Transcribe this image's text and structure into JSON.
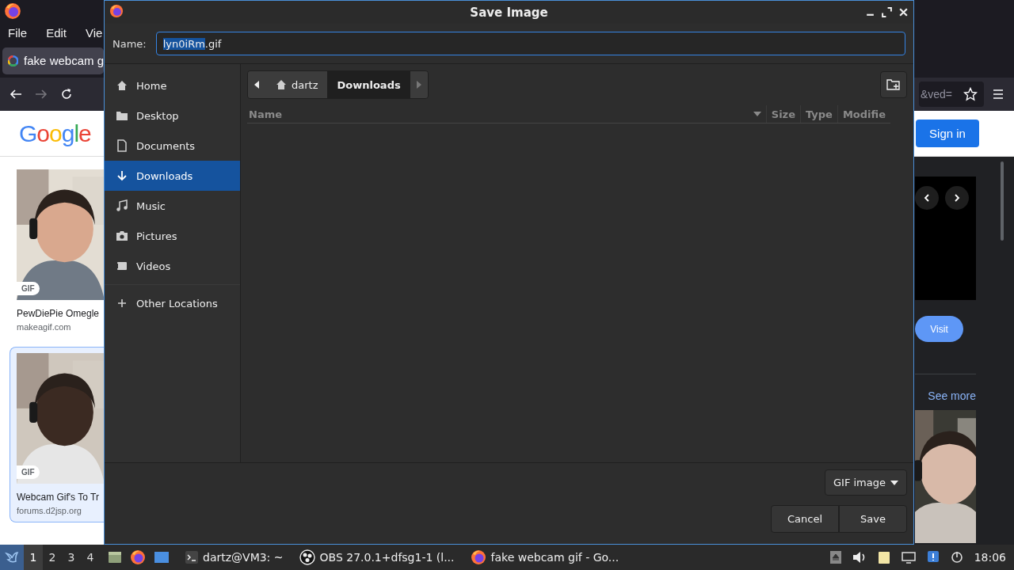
{
  "browser": {
    "menu": [
      "File",
      "Edit",
      "Vie"
    ],
    "tab": {
      "title": "fake webcam g"
    },
    "url_tail": "&ved=",
    "logo": "Google",
    "sign_in": "Sign in",
    "results": [
      {
        "badge": "GIF",
        "title": "PewDiePie Omegle",
        "source": "makeagif.com",
        "selected": false
      },
      {
        "badge": "GIF",
        "title": "Webcam Gif's To Tr",
        "source": "forums.d2jsp.org",
        "selected": true
      }
    ],
    "preview": {
      "visit": "Visit",
      "see_more": "See more"
    }
  },
  "dialog": {
    "title": "Save Image",
    "name_label": "Name:",
    "name_field": {
      "selected_text": "lyn0iRm",
      "rest_text": ".gif"
    },
    "places": [
      {
        "label": "Home",
        "kind": "home",
        "selected": false
      },
      {
        "label": "Desktop",
        "kind": "folder",
        "selected": false
      },
      {
        "label": "Documents",
        "kind": "document",
        "selected": false
      },
      {
        "label": "Downloads",
        "kind": "download",
        "selected": true
      },
      {
        "label": "Music",
        "kind": "music",
        "selected": false
      },
      {
        "label": "Pictures",
        "kind": "camera",
        "selected": false
      },
      {
        "label": "Videos",
        "kind": "video",
        "selected": false
      }
    ],
    "other_locations": "Other Locations",
    "path": [
      {
        "label": "dartz",
        "kind": "home",
        "selected": false
      },
      {
        "label": "Downloads",
        "kind": "plain",
        "selected": true
      }
    ],
    "columns": [
      "Name",
      "Size",
      "Type",
      "Modifie"
    ],
    "file_type": "GIF image",
    "buttons": [
      "Cancel",
      "Save"
    ]
  },
  "taskbar": {
    "workspaces": [
      {
        "label": "1",
        "selected": true
      },
      {
        "label": "2",
        "selected": false
      },
      {
        "label": "3",
        "selected": false
      },
      {
        "label": "4",
        "selected": false
      }
    ],
    "tasks": [
      {
        "label": "dartz@VM3: ~",
        "kind": "terminal"
      },
      {
        "label": "OBS 27.0.1+dfsg1-1 (l...",
        "kind": "obs"
      },
      {
        "label": "fake webcam gif - Go...",
        "kind": "firefox"
      }
    ],
    "clock": "18:06"
  }
}
